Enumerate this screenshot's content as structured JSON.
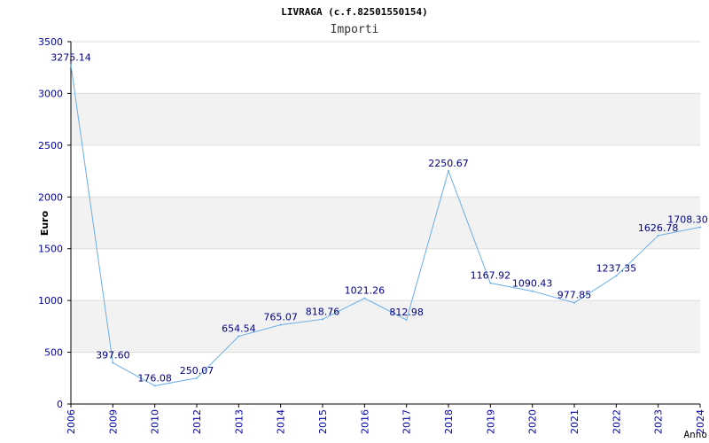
{
  "chart_data": {
    "type": "line",
    "title": "LIVRAGA (c.f.82501550154)",
    "subtitle": "Importi",
    "xlabel": "Anno",
    "ylabel": "Euro",
    "ylim": [
      0,
      3500
    ],
    "yticks": [
      0,
      500,
      1000,
      1500,
      2000,
      2500,
      3000,
      3500
    ],
    "categories": [
      "2006",
      "2009",
      "2010",
      "2012",
      "2013",
      "2014",
      "2015",
      "2016",
      "2017",
      "2018",
      "2019",
      "2020",
      "2021",
      "2022",
      "2023",
      "2024"
    ],
    "values": [
      3275.14,
      397.6,
      176.08,
      250.07,
      654.54,
      765.07,
      818.76,
      1021.26,
      812.98,
      2250.67,
      1167.92,
      1090.43,
      977.85,
      1237.35,
      1626.78,
      1708.3
    ],
    "value_labels": [
      "3275.14",
      "397.60",
      "176.08",
      "250.07",
      "654.54",
      "765.07",
      "818.76",
      "1021.26",
      "812.98",
      "2250.67",
      "1167.92",
      "1090.43",
      "977.85",
      "1237.35",
      "1626.78",
      "1708.30"
    ],
    "grid": true,
    "colors": {
      "line": "#6aaee8",
      "axis_text": "#0000aa",
      "label_text": "#000080",
      "band": "#f2f2f2",
      "grid": "#dddddd"
    }
  }
}
